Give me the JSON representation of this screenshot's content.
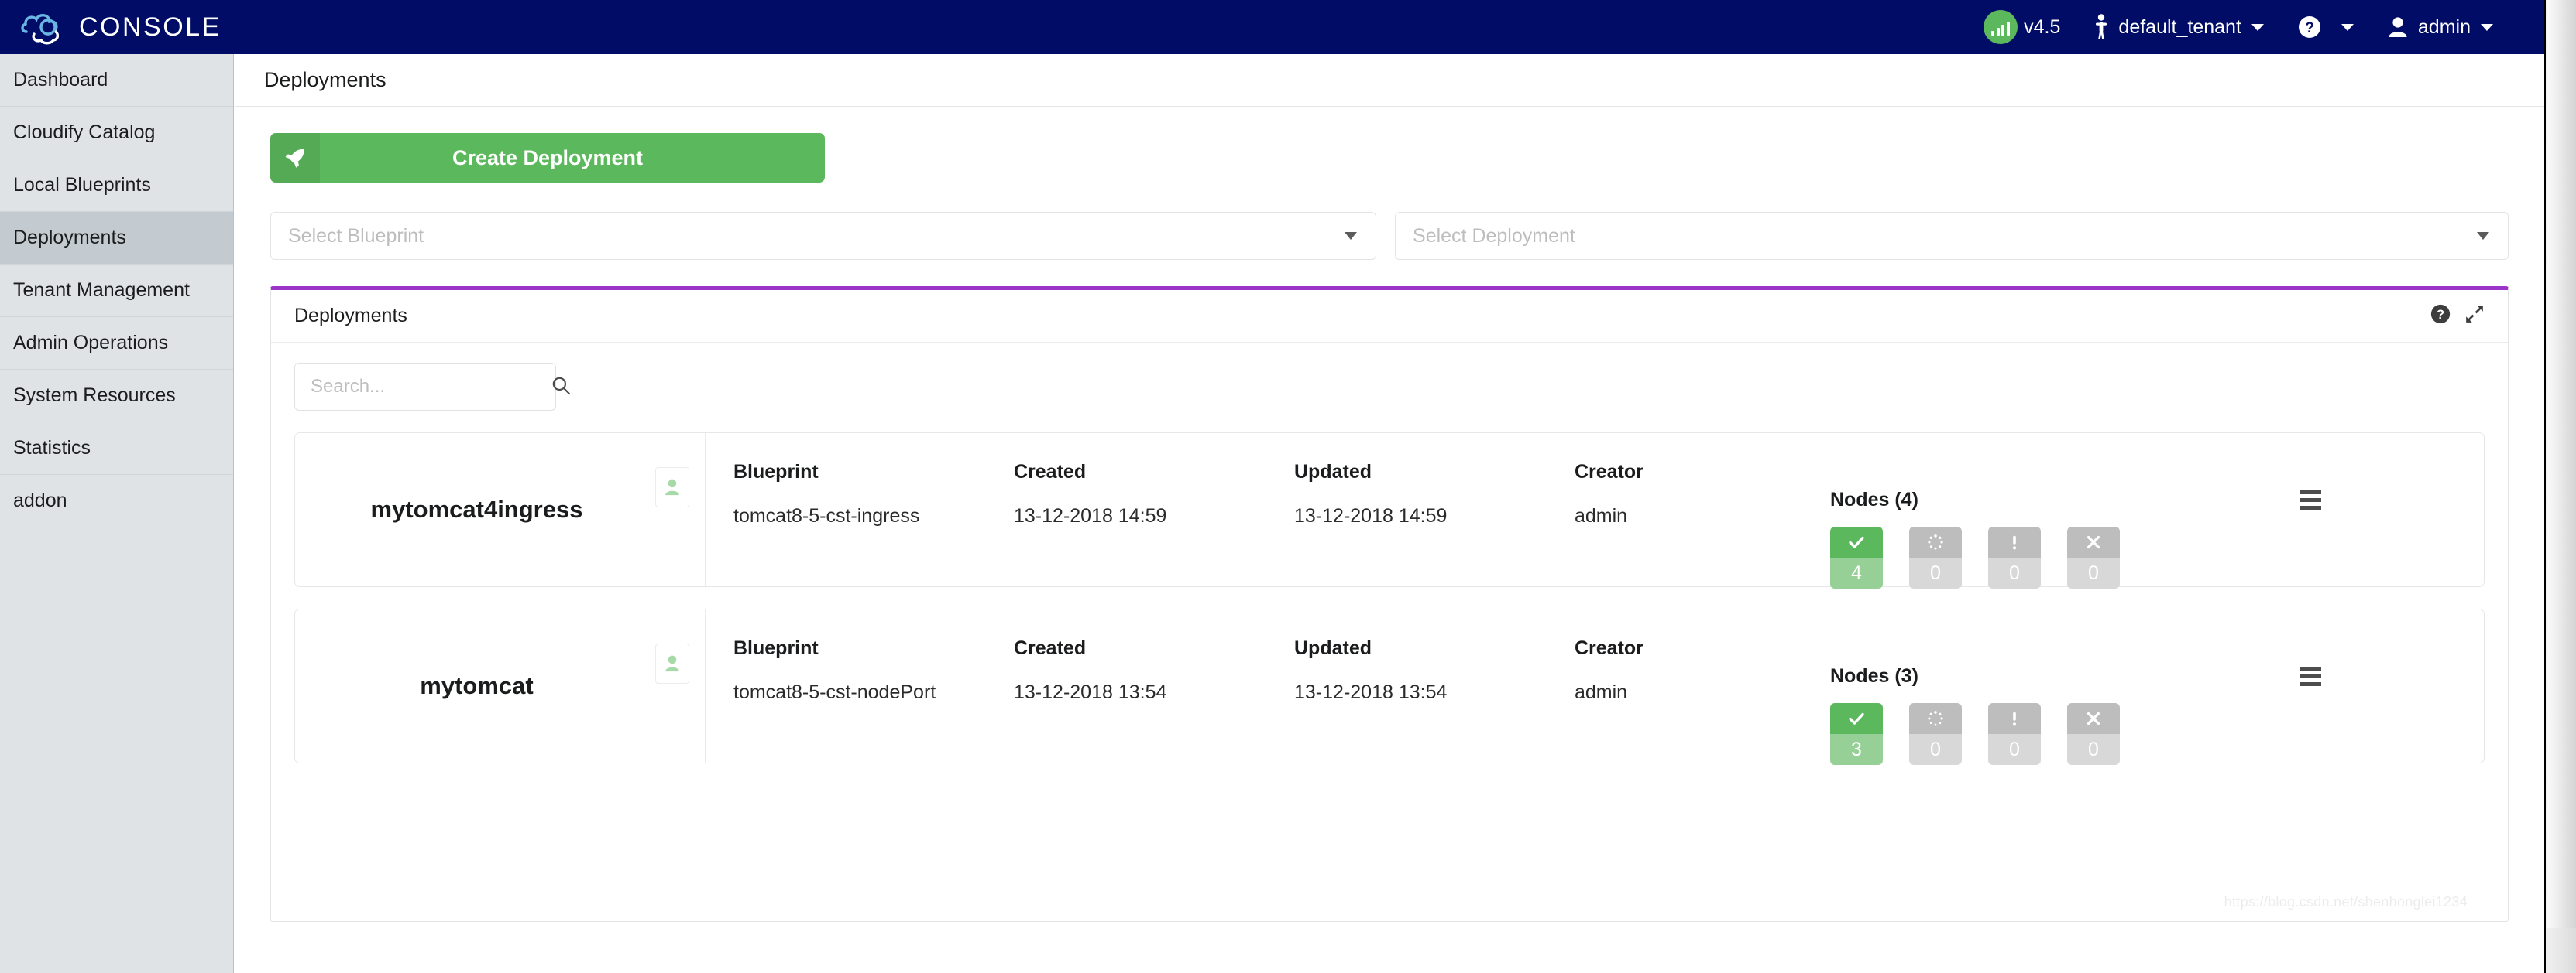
{
  "topbar": {
    "brand": "CONSOLE",
    "brand_logo_icon": "cloud-logo-icon",
    "version_label": "v4.5",
    "version_icon": "signal-bars-icon",
    "tenant_icon": "person-standing-icon",
    "tenant_label": "default_tenant",
    "help_icon": "question-circle-icon",
    "user_icon": "user-icon",
    "user_label": "admin",
    "accent_navy": "#000c66",
    "accent_green": "#5cb85c"
  },
  "sidebar": {
    "items": [
      {
        "label": "Dashboard",
        "active": false
      },
      {
        "label": "Cloudify Catalog",
        "active": false
      },
      {
        "label": "Local Blueprints",
        "active": false
      },
      {
        "label": "Deployments",
        "active": true
      },
      {
        "label": "Tenant Management",
        "active": false
      },
      {
        "label": "Admin Operations",
        "active": false
      },
      {
        "label": "System Resources",
        "active": false
      },
      {
        "label": "Statistics",
        "active": false
      },
      {
        "label": "addon",
        "active": false
      }
    ]
  },
  "page": {
    "title": "Deployments"
  },
  "toolbar": {
    "create_label": "Create Deployment",
    "create_icon": "rocket-icon",
    "blueprint_select_placeholder": "Select Blueprint",
    "deployment_select_placeholder": "Select Deployment",
    "dropdown_icon": "caret-down-icon"
  },
  "panel": {
    "title": "Deployments",
    "accent_color": "#9b34c8",
    "help_icon": "question-circle-icon",
    "expand_icon": "expand-arrows-icon",
    "search_placeholder": "Search...",
    "search_value": "",
    "search_icon": "magnifier-icon",
    "columns": {
      "blueprint": "Blueprint",
      "created": "Created",
      "updated": "Updated",
      "creator": "Creator"
    },
    "node_icons": {
      "ok": "check-icon",
      "loading": "spinner-icon",
      "alert": "exclamation-icon",
      "failed": "cross-icon"
    },
    "row_menu_icon": "hamburger-menu-icon",
    "tenant_badge_icon": "user-badge-icon",
    "rows": [
      {
        "name": "mytomcat4ingress",
        "blueprint": "tomcat8-5-cst-ingress",
        "created": "13-12-2018 14:59",
        "updated": "13-12-2018 14:59",
        "creator": "admin",
        "nodes_label": "Nodes (4)",
        "nodes": {
          "ok": "4",
          "loading": "0",
          "alert": "0",
          "failed": "0"
        }
      },
      {
        "name": "mytomcat",
        "blueprint": "tomcat8-5-cst-nodePort",
        "created": "13-12-2018 13:54",
        "updated": "13-12-2018 13:54",
        "creator": "admin",
        "nodes_label": "Nodes (3)",
        "nodes": {
          "ok": "3",
          "loading": "0",
          "alert": "0",
          "failed": "0"
        }
      }
    ]
  },
  "watermark": "https://blog.csdn.net/shenhonglei1234"
}
